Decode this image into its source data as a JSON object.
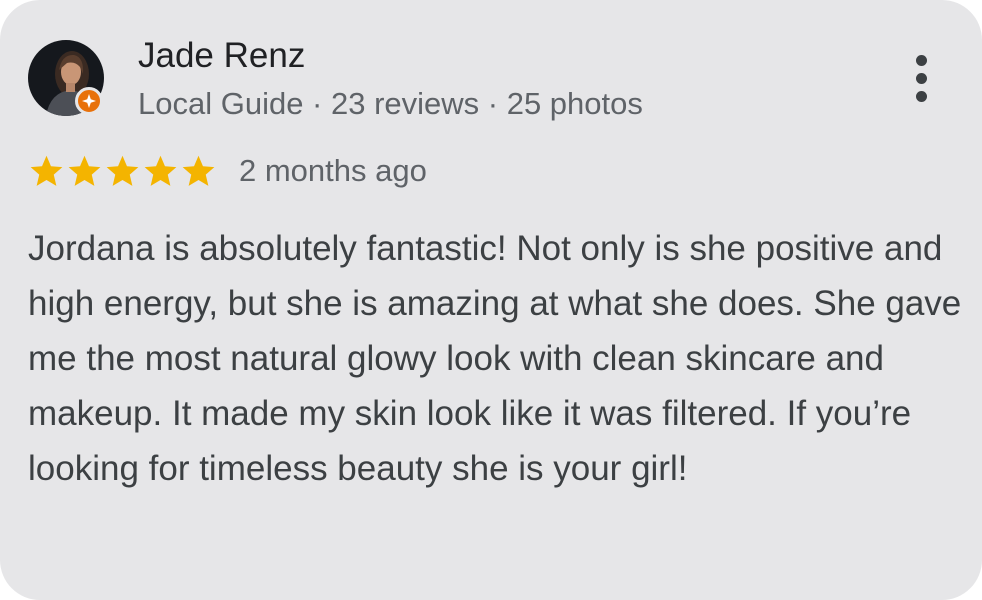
{
  "review": {
    "reviewer": {
      "name": "Jade Renz",
      "meta": "Local Guide · 23 reviews · 25 photos",
      "avatar_icon": "profile-photo",
      "badge_icon": "local-guide-badge-icon"
    },
    "rating": {
      "stars": 5,
      "max_stars": 5,
      "star_color": "#f4b400"
    },
    "date": "2 months ago",
    "text": "Jordana is absolutely fantastic! Not only is she positive and high energy, but she is amazing at what she does. She gave me the most natural glowy look with clean skincare and makeup. It made my skin look like it was filtered. If you’re looking for timeless beauty she is your girl!",
    "menu_icon": "more-vert-icon"
  },
  "colors": {
    "card_background": "#e6e6e8",
    "badge": "#e8710a",
    "primary_text": "#202124",
    "secondary_text": "#5f6368"
  }
}
